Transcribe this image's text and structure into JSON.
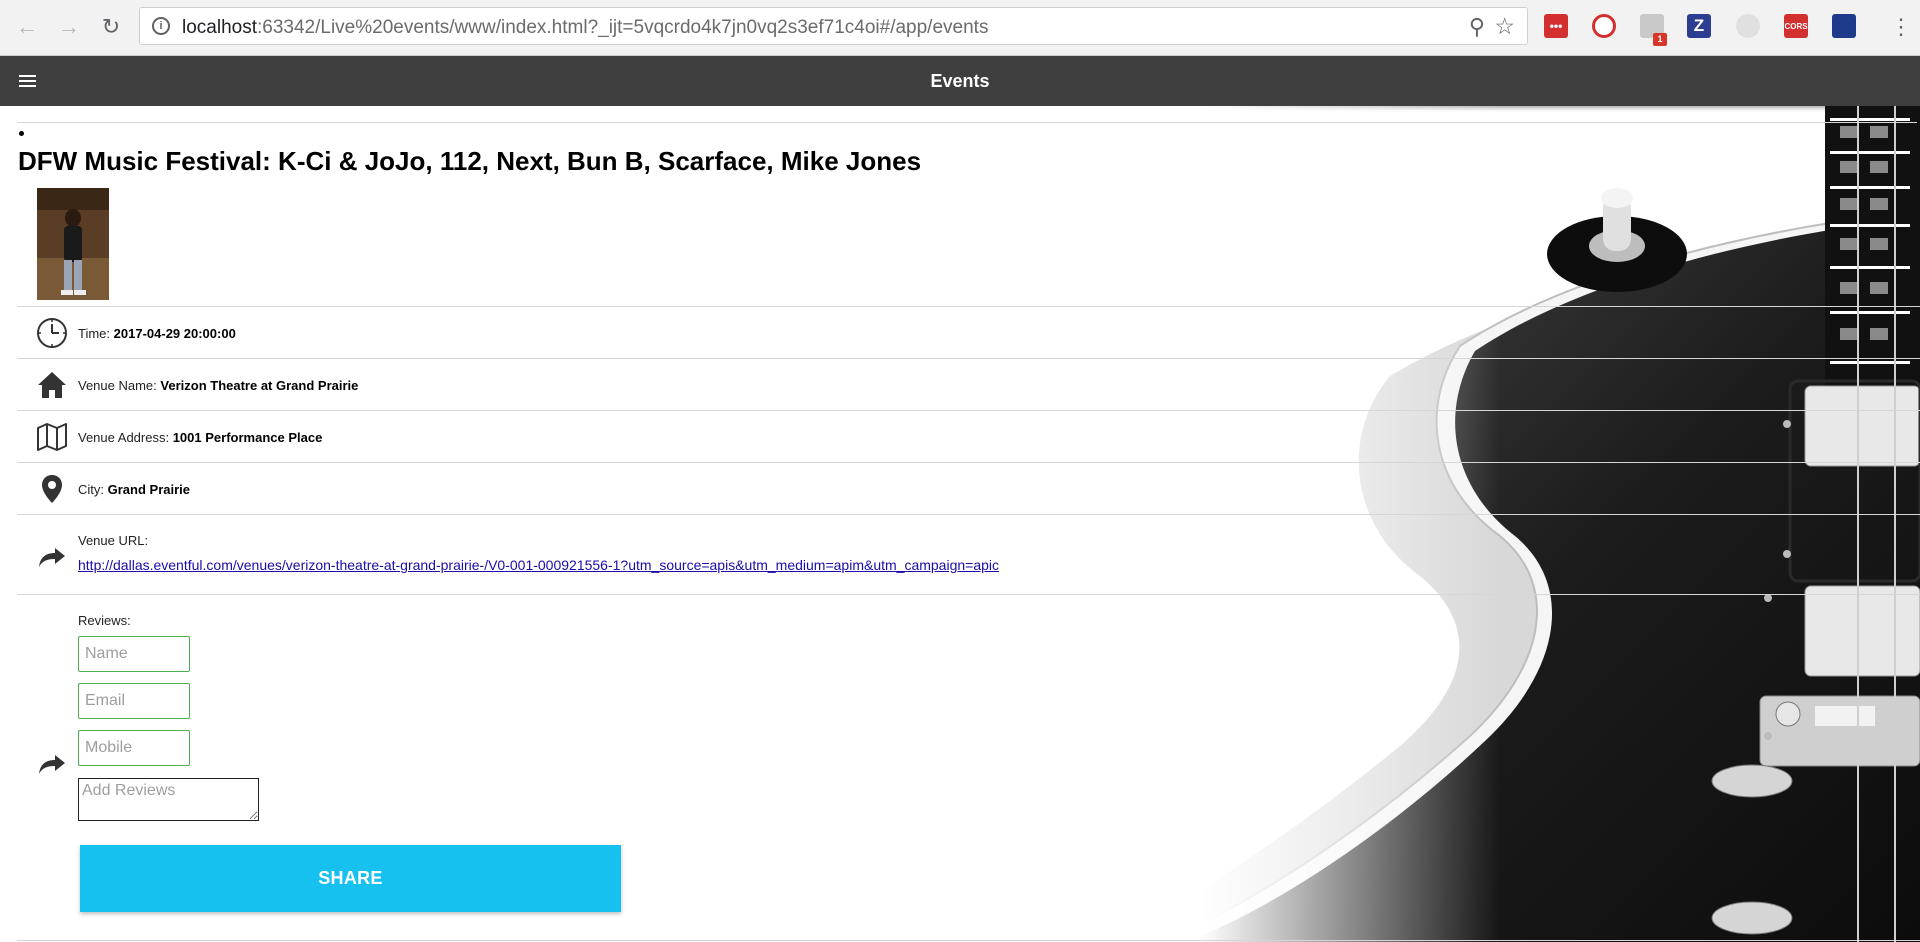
{
  "browser": {
    "url_host": "localhost",
    "url_path": ":63342/Live%20events/www/index.html?_ijt=5vqcrdo4k7jn0vq2s3ef71c4oi#/app/events",
    "ext_badge": "1",
    "ext_z": "Z",
    "ext_cors": "CORS"
  },
  "app": {
    "title": "Events"
  },
  "event": {
    "title": "DFW Music Festival: K-Ci & JoJo, 112, Next, Bun B, Scarface, Mike Jones",
    "time_label": "Time:",
    "time_value": "2017-04-29 20:00:00",
    "venue_name_label": "Venue Name:",
    "venue_name_value": "Verizon Theatre at Grand Prairie",
    "venue_address_label": "Venue Address:",
    "venue_address_value": "1001 Performance Place",
    "city_label": "City:",
    "city_value": "Grand Prairie",
    "venue_url_label": "Venue URL:",
    "venue_url_value": "http://dallas.eventful.com/venues/verizon-theatre-at-grand-prairie-/V0-001-000921556-1?utm_source=apis&utm_medium=apim&utm_campaign=apic"
  },
  "reviews": {
    "label": "Reviews:",
    "name_placeholder": "Name",
    "email_placeholder": "Email",
    "mobile_placeholder": "Mobile",
    "review_placeholder": "Add Reviews",
    "share_label": "SHARE"
  },
  "colors": {
    "appbar": "#3f3f3f",
    "share_button": "#16c0ef",
    "field_border": "#4caf50",
    "link": "#1a0dab"
  }
}
